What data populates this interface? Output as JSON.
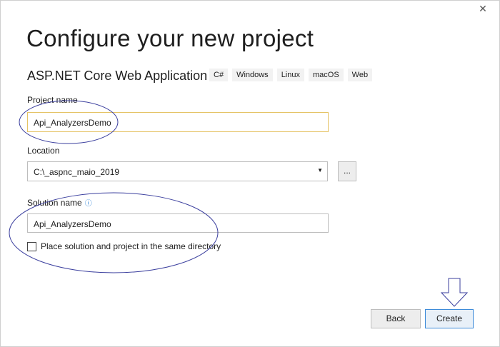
{
  "dialog": {
    "close_glyph": "✕",
    "title": "Configure your new project",
    "template_name": "ASP.NET Core Web Application",
    "tags": [
      "C#",
      "Windows",
      "Linux",
      "macOS",
      "Web"
    ]
  },
  "project_name": {
    "label": "Project name",
    "value": "Api_AnalyzersDemo"
  },
  "location": {
    "label": "Location",
    "value": "C:\\_aspnc_maio_2019",
    "browse_label": "..."
  },
  "solution_name": {
    "label": "Solution name",
    "value": "Api_AnalyzersDemo",
    "info_glyph": "ⓘ"
  },
  "same_directory": {
    "label": "Place solution and project in the same directory",
    "checked": false
  },
  "buttons": {
    "back": "Back",
    "create": "Create"
  },
  "annotation_color": "#3b3f9e"
}
